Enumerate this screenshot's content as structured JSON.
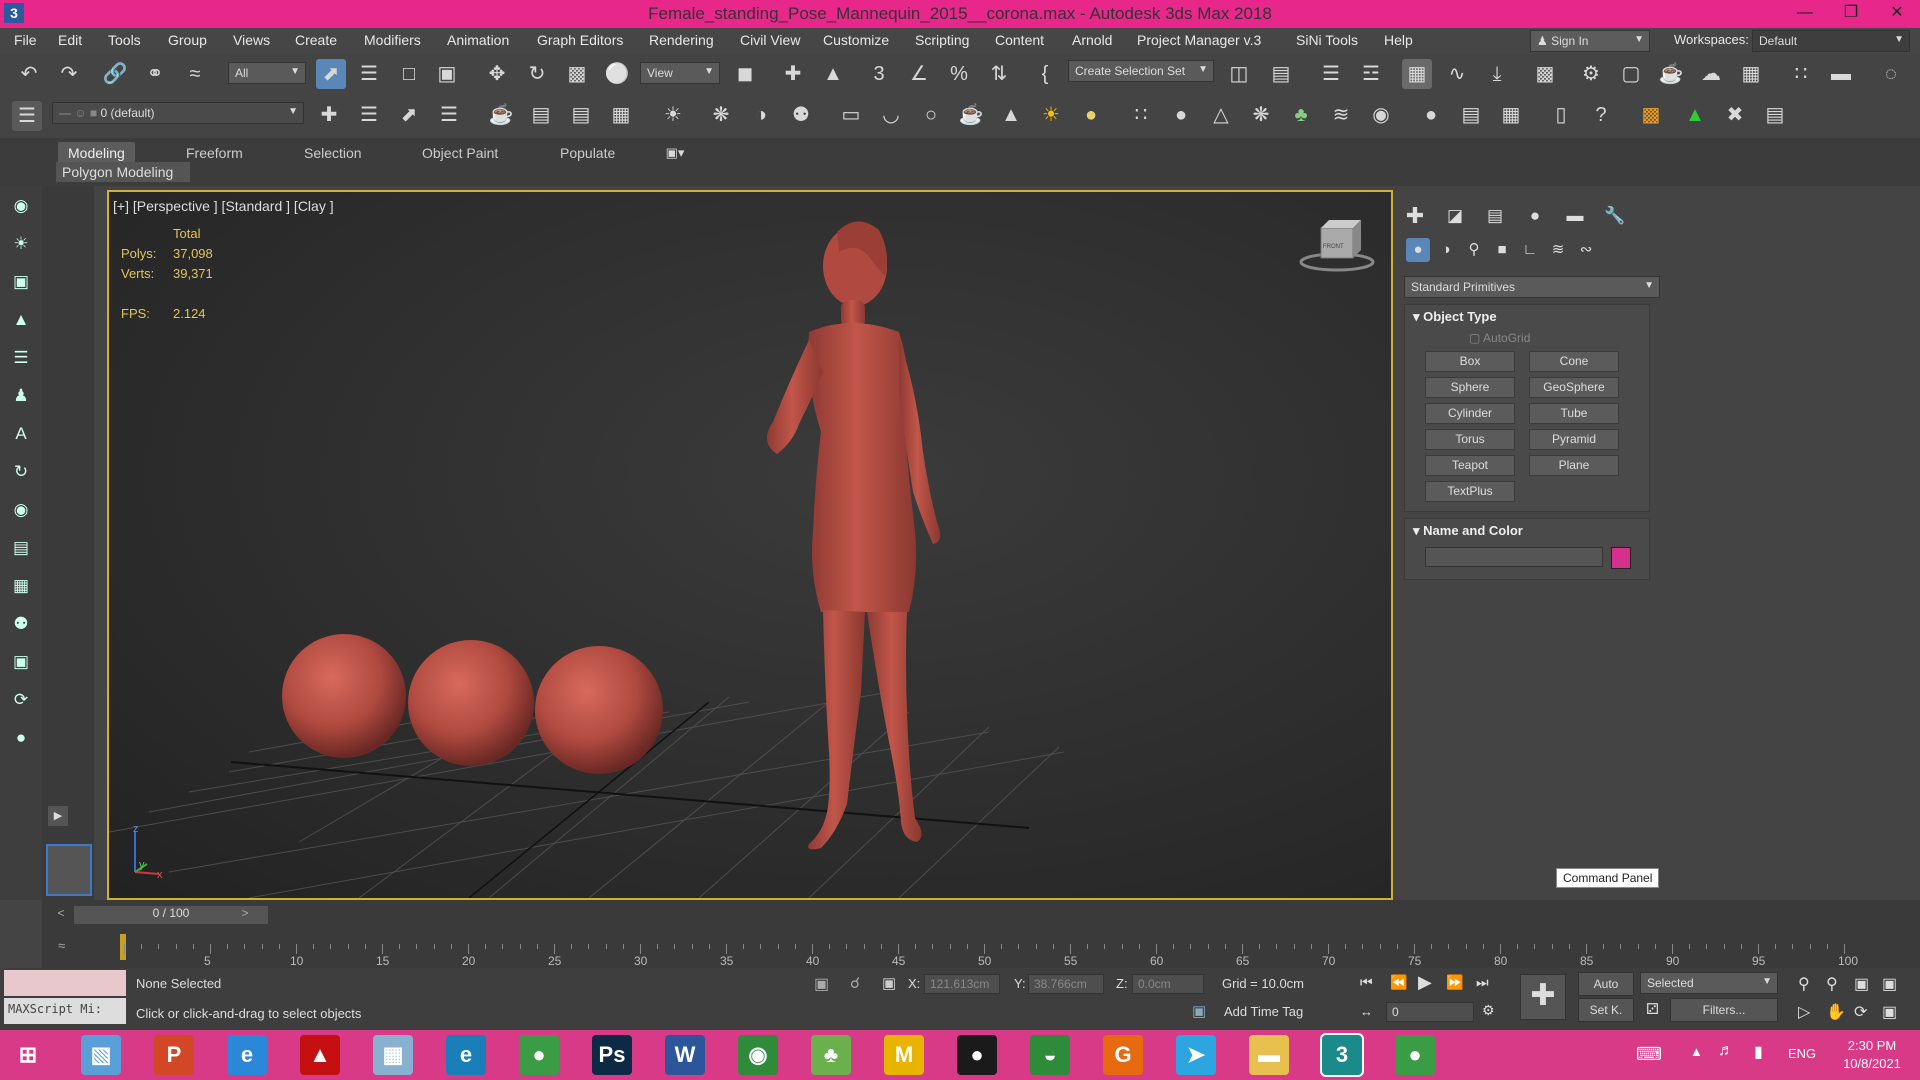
{
  "window": {
    "title": "Female_standing_Pose_Mannequin_2015__corona.max - Autodesk 3ds Max 2018",
    "app_icon": "3",
    "minimize": "—",
    "restore": "❐",
    "close": "✕"
  },
  "menubar": {
    "items": [
      "File",
      "Edit",
      "Tools",
      "Group",
      "Views",
      "Create",
      "Modifiers",
      "Animation",
      "Graph Editors",
      "Rendering",
      "Civil View",
      "Customize",
      "Scripting",
      "Content",
      "Arnold",
      "Project Manager v.3",
      "SiNi Tools",
      "Help"
    ],
    "sign_in": "Sign In",
    "workspaces_label": "Workspaces:",
    "workspace_value": "Default"
  },
  "toolbar": {
    "filter_value": "All",
    "refcoord_value": "View",
    "selection_set_value": "Create Selection Set",
    "layer_value": "0 (default)"
  },
  "ribbon": {
    "tabs": [
      "Modeling",
      "Freeform",
      "Selection",
      "Object Paint",
      "Populate"
    ],
    "active_tab": "Modeling",
    "sub_label": "Polygon Modeling"
  },
  "viewport": {
    "label": "[+] [Perspective ] [Standard ] [Clay ]",
    "stats_total": "Total",
    "polys_label": "Polys:",
    "polys_value": "37,098",
    "verts_label": "Verts:",
    "verts_value": "39,371",
    "fps_label": "FPS:",
    "fps_value": "2.124",
    "axis_z": "z",
    "axis_y": "y",
    "axis_x": "x",
    "viewcube_label": "FRONT"
  },
  "command_panel": {
    "dropdown_value": "Standard Primitives",
    "object_type_header": "Object Type",
    "autogrid_label": "AutoGrid",
    "primitives": [
      "Box",
      "Cone",
      "Sphere",
      "GeoSphere",
      "Cylinder",
      "Tube",
      "Torus",
      "Pyramid",
      "Teapot",
      "Plane",
      "TextPlus"
    ],
    "name_color_header": "Name and Color",
    "name_value": "",
    "swatch_color": "#d6318a",
    "tooltip": "Command Panel"
  },
  "timeline": {
    "frame_counter": "0 / 100",
    "prev": "<",
    "next": ">",
    "tick_labels": [
      "5",
      "10",
      "15",
      "20",
      "25",
      "30",
      "35",
      "40",
      "45",
      "50",
      "55",
      "60",
      "65",
      "70",
      "75",
      "80",
      "85",
      "90",
      "95",
      "100"
    ]
  },
  "status": {
    "maxscript_placeholder": "MAXScript Mi:",
    "selection_text": "None Selected",
    "prompt_text": "Click or click-and-drag to select objects",
    "x_label": "X:",
    "x_value": "121.613cm",
    "y_label": "Y:",
    "y_value": "38.766cm",
    "z_label": "Z:",
    "z_value": "0.0cm",
    "grid_text": "Grid = 10.0cm",
    "add_time_tag": "Add Time Tag",
    "auto_label": "Auto",
    "setk_label": "Set K.",
    "selected_value": "Selected",
    "filters_label": "Filters...",
    "frame_value": "0"
  },
  "taskbar": {
    "apps": [
      {
        "name": "start-button",
        "glyph": "⊞",
        "color": "#d83a88"
      },
      {
        "name": "file-explorer-icon",
        "glyph": "▧",
        "color": "#5aa0d8"
      },
      {
        "name": "powerpoint-icon",
        "glyph": "P",
        "color": "#d24726"
      },
      {
        "name": "internet-explorer-icon",
        "glyph": "e",
        "color": "#2b88d8"
      },
      {
        "name": "acrobat-icon",
        "glyph": "▲",
        "color": "#c41010"
      },
      {
        "name": "calculator-icon",
        "glyph": "▦",
        "color": "#8ab0d0"
      },
      {
        "name": "edge-e-icon",
        "glyph": "e",
        "color": "#1a7fb8"
      },
      {
        "name": "chrome-icon",
        "glyph": "●",
        "color": "#3a9d45"
      },
      {
        "name": "photoshop-icon",
        "glyph": "Ps",
        "color": "#0d2a44"
      },
      {
        "name": "word-icon",
        "glyph": "W",
        "color": "#2b579a"
      },
      {
        "name": "globe-icon",
        "glyph": "◉",
        "color": "#2f8a3a"
      },
      {
        "name": "tree-icon",
        "glyph": "♣",
        "color": "#6ab04c"
      },
      {
        "name": "m-app-icon",
        "glyph": "M",
        "color": "#e8b400"
      },
      {
        "name": "record-icon",
        "glyph": "●",
        "color": "#1a1a1a"
      },
      {
        "name": "android-icon",
        "glyph": "◒",
        "color": "#2e8b3a"
      },
      {
        "name": "g-app-icon",
        "glyph": "G",
        "color": "#e86a10"
      },
      {
        "name": "telegram-icon",
        "glyph": "➤",
        "color": "#2ca5e0"
      },
      {
        "name": "folder-icon",
        "glyph": "▬",
        "color": "#e8c050"
      },
      {
        "name": "3dsmax-icon",
        "glyph": "3",
        "color": "#1a8a8a"
      },
      {
        "name": "chrome2-icon",
        "glyph": "●",
        "color": "#3a9d45"
      }
    ],
    "lang": "ENG",
    "time": "2:30 PM",
    "date": "10/8/2021"
  }
}
